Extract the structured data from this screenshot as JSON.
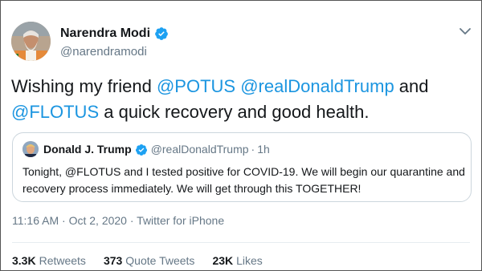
{
  "author": {
    "name": "Narendra Modi",
    "handle": "@narendramodi"
  },
  "tweet": {
    "parts": [
      {
        "text": "Wishing my friend ",
        "type": "text"
      },
      {
        "text": "@POTUS",
        "type": "mention"
      },
      {
        "text": " ",
        "type": "text"
      },
      {
        "text": "@realDonaldTrump",
        "type": "mention"
      },
      {
        "text": " and ",
        "type": "text"
      },
      {
        "text": "@FLOTUS",
        "type": "mention"
      },
      {
        "text": " a quick recovery and good health.",
        "type": "text"
      }
    ]
  },
  "quoted": {
    "name": "Donald J. Trump",
    "handle": "@realDonaldTrump",
    "separator": "·",
    "time": "1h",
    "text": "Tonight, @FLOTUS and I tested positive for COVID-19. We will begin our quarantine and recovery process immediately. We will get through this TOGETHER!"
  },
  "meta": {
    "time": "11:16 AM",
    "separator1": "·",
    "date": "Oct 2, 2020",
    "separator2": "·",
    "source": "Twitter for iPhone"
  },
  "stats": {
    "retweets_count": "3.3K",
    "retweets_label": "Retweets",
    "quotes_count": "373",
    "quotes_label": "Quote Tweets",
    "likes_count": "23K",
    "likes_label": "Likes"
  },
  "icons": {
    "verified": "verified-badge-icon",
    "more": "chevron-down-icon"
  },
  "colors": {
    "link": "#1b95e0",
    "muted": "#657786",
    "verified": "#1da1f2",
    "border": "#ccd6dd"
  }
}
